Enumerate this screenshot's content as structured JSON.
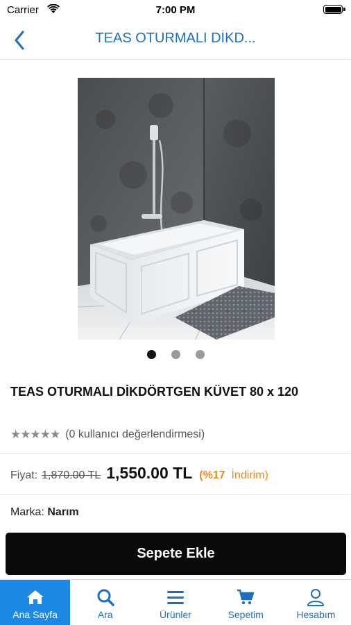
{
  "status_bar": {
    "carrier": "Carrier",
    "time": "7:00 PM"
  },
  "nav": {
    "title": "TEAS OTURMALI DİKD..."
  },
  "gallery": {
    "image_count": 3,
    "active_index": 0
  },
  "product": {
    "title": "TEAS OTURMALI DİKDÖRTGEN KÜVET 80 x 120",
    "rating_stars": 5,
    "rating_text": "(0 kullanıcı değerlendirmesi)",
    "price_label": "Fiyat:",
    "old_price": "1,870.00 TL",
    "new_price": "1,550.00 TL",
    "discount_percent": "(%17",
    "discount_word": "İndirim)",
    "brand_label": "Marka:",
    "brand_value": "Narım"
  },
  "add_to_cart_label": "Sepete Ekle",
  "tabs": [
    {
      "label": "Ana Sayfa",
      "icon": "home-icon",
      "active": true
    },
    {
      "label": "Ara",
      "icon": "search-icon",
      "active": false
    },
    {
      "label": "Ürünler",
      "icon": "menu-icon",
      "active": false
    },
    {
      "label": "Sepetim",
      "icon": "cart-icon",
      "active": false
    },
    {
      "label": "Hesabım",
      "icon": "user-icon",
      "active": false
    }
  ],
  "colors": {
    "accent": "#1b6fc2",
    "active_tab_bg": "#1e88e5",
    "discount": "#f08a1c",
    "button_bg": "#0a0a0a"
  }
}
